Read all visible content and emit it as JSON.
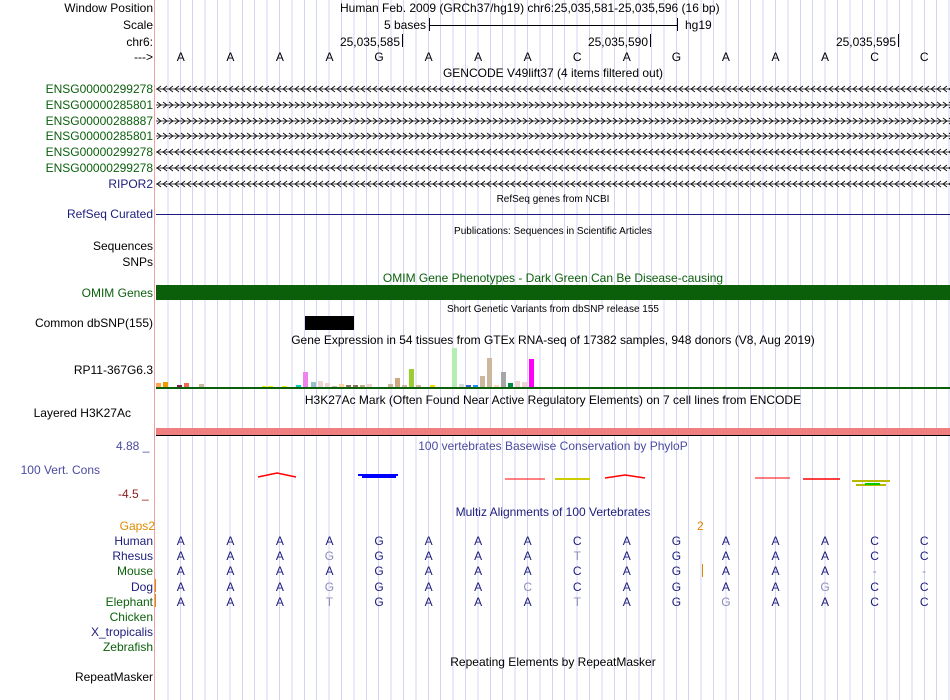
{
  "header": {
    "window_position_label": "Window Position",
    "position_text": "Human Feb. 2009 (GRCh37/hg19)   chr6:25,035,581-25,035,596 (16 bp)",
    "scale_label": "Scale",
    "scale_text": "5 bases",
    "scale_db": "hg19",
    "chrom_label": "chr6:",
    "ticks": [
      "25,035,585",
      "25,035,590",
      "25,035,595"
    ],
    "strand_label": "--->",
    "bases": "AAAAGAAACAGAAACC"
  },
  "gencode": {
    "title": "GENCODE V49lift37 (4 items filtered out)",
    "genes": [
      {
        "name": "ENSG00000299278",
        "strand": "-"
      },
      {
        "name": "ENSG00000285801",
        "strand": "+"
      },
      {
        "name": "ENSG00000288887",
        "strand": "+"
      },
      {
        "name": "ENSG00000285801",
        "strand": "+"
      },
      {
        "name": "ENSG00000299278",
        "strand": "-"
      },
      {
        "name": "ENSG00000299278",
        "strand": "-"
      },
      {
        "name": "RIPOR2",
        "strand": "-"
      }
    ]
  },
  "refseq": {
    "title": "RefSeq genes from NCBI",
    "label": "RefSeq Curated"
  },
  "publications": {
    "title": "Publications: Sequences in Scientific Articles",
    "label1": "Sequences",
    "label2": "SNPs"
  },
  "omim": {
    "title": "OMIM Gene Phenotypes - Dark Green Can Be Disease-causing",
    "label": "OMIM Genes",
    "color": "#0b5f0b"
  },
  "dbsnp": {
    "title": "Short Genetic Variants from dbSNP release 155",
    "label": "Common dbSNP(155)"
  },
  "gtex": {
    "title": "Gene Expression in 54 tissues from GTEx RNA-seq of 17382 samples, 948 donors (V8, Aug 2019)",
    "label": "RP11-367G6.3",
    "bars": [
      [
        156,
        4,
        "#FFA54F"
      ],
      [
        163,
        5,
        "#EE9A00"
      ],
      [
        177,
        2,
        "#7A1F4F"
      ],
      [
        184,
        4,
        "#EE6A50"
      ],
      [
        199,
        3,
        "#CDB79E"
      ],
      [
        262,
        1,
        "#EEEE00"
      ],
      [
        268,
        1,
        "#EEEE00"
      ],
      [
        282,
        1,
        "#EEEE00"
      ],
      [
        296,
        2,
        "#00CED1"
      ],
      [
        303,
        15,
        "#EE82EE"
      ],
      [
        311,
        5,
        "#9AC0CD"
      ],
      [
        318,
        6,
        "#EED5D2"
      ],
      [
        325,
        4,
        "#EED5D2"
      ],
      [
        332,
        1,
        "#CDB79E"
      ],
      [
        339,
        3,
        "#FFD39B"
      ],
      [
        346,
        2,
        "#8B7355"
      ],
      [
        353,
        2,
        "#8B7355"
      ],
      [
        360,
        2,
        "#CDAA7D"
      ],
      [
        367,
        3,
        "#EED5D2"
      ],
      [
        388,
        3,
        "#CDB79E"
      ],
      [
        395,
        9,
        "#CDAA7D"
      ],
      [
        402,
        2,
        "#CDB79E"
      ],
      [
        409,
        18,
        "#9ACD32"
      ],
      [
        416,
        2,
        "#CDB79E"
      ],
      [
        430,
        2,
        "#FFD700"
      ],
      [
        452,
        39,
        "#B4EEB4"
      ],
      [
        459,
        3,
        "#D9D9D9"
      ],
      [
        466,
        2,
        "#3A5FCD"
      ],
      [
        473,
        2,
        "#1E90FF"
      ],
      [
        480,
        11,
        "#CDB79E"
      ],
      [
        487,
        29,
        "#CDB79E"
      ],
      [
        494,
        2,
        "#FFDAB9"
      ],
      [
        501,
        15,
        "#A6A6A6"
      ],
      [
        508,
        4,
        "#008B45"
      ],
      [
        515,
        6,
        "#EED5D2"
      ],
      [
        522,
        5,
        "#EED5D2"
      ],
      [
        529,
        28,
        "#FF00FF"
      ]
    ]
  },
  "h3k27ac": {
    "title": "H3K27Ac Mark (Often Found Near Active Regulatory Elements) on 7 cell lines from ENCODE",
    "label": "Layered H3K27Ac",
    "color": "#f08080"
  },
  "phylop": {
    "title": "100 vertebrates Basewise Conservation by PhyloP",
    "label": "100 Vert. Cons",
    "max": "4.88 _",
    "min": "-4.5 _"
  },
  "multiz": {
    "title": "Multiz Alignments of 100 Vertebrates",
    "gaps_label": "Gaps",
    "gap_counts": [
      "2",
      "2"
    ],
    "species": [
      {
        "name": "Human",
        "seq": "AAAAGAAACAGAAACC",
        "color": "navy"
      },
      {
        "name": "Rhesus",
        "seq": "AAAGGAAATAGAAACC",
        "color": "navy"
      },
      {
        "name": "Mouse",
        "seq": "AAAAGAAACAGAAA--",
        "color": "green"
      },
      {
        "name": "Dog",
        "seq": "AAAGGAACCAGAAGCC",
        "color": "navy"
      },
      {
        "name": "Elephant",
        "seq": "AAATGAAATAGGAACC",
        "color": "green"
      },
      {
        "name": "Chicken",
        "seq": "",
        "color": "green"
      },
      {
        "name": "X_tropicalis",
        "seq": "",
        "color": "navy"
      },
      {
        "name": "Zebrafish",
        "seq": "",
        "color": "green"
      }
    ]
  },
  "repeatmasker": {
    "title": "Repeating Elements by RepeatMasker",
    "label": "RepeatMasker"
  }
}
